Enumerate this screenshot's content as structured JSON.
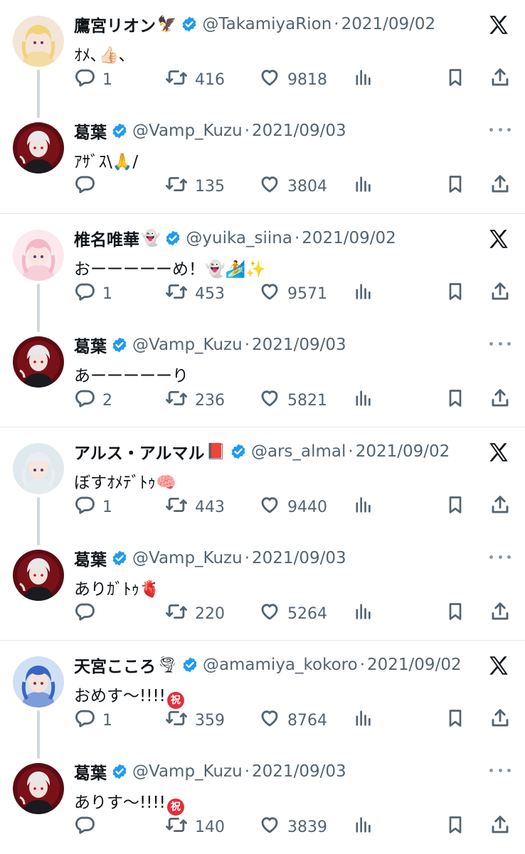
{
  "threads": [
    {
      "original": {
        "name": "鷹宮リオン",
        "name_emoji": "🦅",
        "handle": "@TakamiyaRion",
        "date": "2021/09/02",
        "text": "ｵﾒ､👍🏻､",
        "replies": "1",
        "retweets": "416",
        "likes": "9818",
        "avatar_colors": {
          "bg": "#f3e6d8",
          "hair": "#f2d27a",
          "skin": "#f8e2d4"
        }
      },
      "reply": {
        "name": "葛葉",
        "handle": "@Vamp_Kuzu",
        "date": "2021/09/03",
        "text": "ｱｻﾞｽ\\🙏/",
        "replies": "",
        "retweets": "135",
        "likes": "3804"
      }
    },
    {
      "original": {
        "name": "椎名唯華",
        "name_emoji": "👻",
        "handle": "@yuika_siina",
        "date": "2021/09/02",
        "text": "おーーーーーめ！👻🏄✨",
        "replies": "1",
        "retweets": "453",
        "likes": "9571",
        "avatar_colors": {
          "bg": "#fbe9ee",
          "hair": "#f2b9c8",
          "skin": "#fbe3e0"
        }
      },
      "reply": {
        "name": "葛葉",
        "handle": "@Vamp_Kuzu",
        "date": "2021/09/03",
        "text": "あーーーーーり",
        "replies": "2",
        "retweets": "236",
        "likes": "5821"
      }
    },
    {
      "original": {
        "name": "アルス・アルマル",
        "name_emoji": "📕",
        "handle": "@ars_almal",
        "date": "2021/09/02",
        "text": "ぼすｵﾒﾃﾞﾄｩ🧠",
        "replies": "1",
        "retweets": "443",
        "likes": "9440",
        "avatar_colors": {
          "bg": "#dfe9ee",
          "hair": "#e9eef2",
          "skin": "#f6e6df"
        }
      },
      "reply": {
        "name": "葛葉",
        "handle": "@Vamp_Kuzu",
        "date": "2021/09/03",
        "text": "ありｶﾞﾄｩ🫀",
        "replies": "",
        "retweets": "220",
        "likes": "5264"
      }
    },
    {
      "original": {
        "name": "天宮こころ",
        "name_emoji": "🌪",
        "handle": "@amamiya_kokoro",
        "date": "2021/09/02",
        "text": "おめす〜!!!!",
        "text_badge": "祝",
        "replies": "1",
        "retweets": "359",
        "likes": "8764",
        "avatar_colors": {
          "bg": "#cfe0f4",
          "hair": "#3a64c4",
          "skin": "#f6e2d8"
        }
      },
      "reply": {
        "name": "葛葉",
        "handle": "@Vamp_Kuzu",
        "date": "2021/09/03",
        "text": "ありす〜!!!!",
        "text_badge": "祝",
        "replies": "",
        "retweets": "140",
        "likes": "3839"
      }
    }
  ],
  "colors": {
    "verified": "#1d9bf0",
    "muted": "#536471",
    "line": "#cfd9de"
  },
  "icons": [
    "reply-icon",
    "retweet-icon",
    "like-icon",
    "views-icon",
    "bookmark-icon",
    "share-icon",
    "x-logo-icon",
    "more-icon",
    "verified-icon"
  ]
}
